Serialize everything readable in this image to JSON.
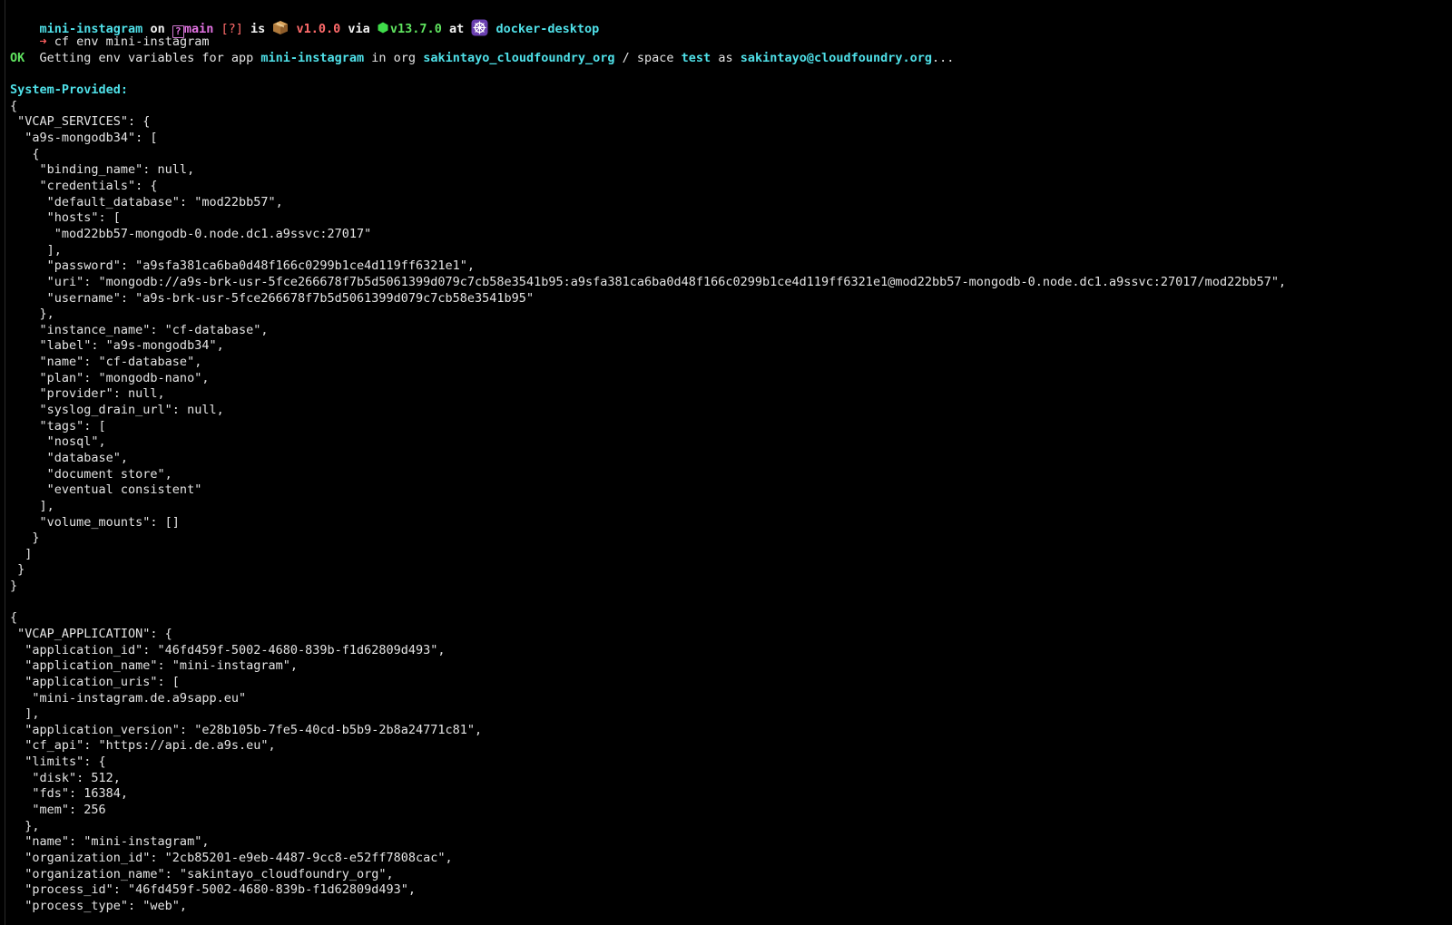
{
  "prompt": {
    "directory": "mini-instagram",
    "on_word": " on ",
    "branch": "main",
    "status": " [?]",
    "is_word": " is ",
    "package_version": " v1.0.0",
    "via_word": " via ",
    "node_version": "v13.7.0",
    "at_word": " at ",
    "context": " docker-desktop"
  },
  "command": {
    "arrow": "➜",
    "text": " cf env mini-instagram"
  },
  "info": {
    "p1": "Getting env variables for app ",
    "app": "mini-instagram",
    "p2": " in org ",
    "org": "sakintayo_cloudfoundry_org",
    "p3": " / space ",
    "space": "test",
    "p4": " as ",
    "user": "sakintayo@cloudfoundry.org",
    "p5": "..."
  },
  "ok": "OK",
  "section_header": "System-Provided:",
  "output_lines": [
    "{",
    " \"VCAP_SERVICES\": {",
    "  \"a9s-mongodb34\": [",
    "   {",
    "    \"binding_name\": null,",
    "    \"credentials\": {",
    "     \"default_database\": \"mod22bb57\",",
    "     \"hosts\": [",
    "      \"mod22bb57-mongodb-0.node.dc1.a9ssvc:27017\"",
    "     ],",
    "     \"password\": \"a9sfa381ca6ba0d48f166c0299b1ce4d119ff6321e1\",",
    "     \"uri\": \"mongodb://a9s-brk-usr-5fce266678f7b5d5061399d079c7cb58e3541b95:a9sfa381ca6ba0d48f166c0299b1ce4d119ff6321e1@mod22bb57-mongodb-0.node.dc1.a9ssvc:27017/mod22bb57\",",
    "     \"username\": \"a9s-brk-usr-5fce266678f7b5d5061399d079c7cb58e3541b95\"",
    "    },",
    "    \"instance_name\": \"cf-database\",",
    "    \"label\": \"a9s-mongodb34\",",
    "    \"name\": \"cf-database\",",
    "    \"plan\": \"mongodb-nano\",",
    "    \"provider\": null,",
    "    \"syslog_drain_url\": null,",
    "    \"tags\": [",
    "     \"nosql\",",
    "     \"database\",",
    "     \"document store\",",
    "     \"eventual consistent\"",
    "    ],",
    "    \"volume_mounts\": []",
    "   }",
    "  ]",
    " }",
    "}",
    "",
    "{",
    " \"VCAP_APPLICATION\": {",
    "  \"application_id\": \"46fd459f-5002-4680-839b-f1d62809d493\",",
    "  \"application_name\": \"mini-instagram\",",
    "  \"application_uris\": [",
    "   \"mini-instagram.de.a9sapp.eu\"",
    "  ],",
    "  \"application_version\": \"e28b105b-7fe5-40cd-b5b9-2b8a24771c81\",",
    "  \"cf_api\": \"https://api.de.a9s.eu\",",
    "  \"limits\": {",
    "   \"disk\": 512,",
    "   \"fds\": 16384,",
    "   \"mem\": 256",
    "  },",
    "  \"name\": \"mini-instagram\",",
    "  \"organization_id\": \"2cb85201-e9eb-4487-9cc8-e52ff7808cac\",",
    "  \"organization_name\": \"sakintayo_cloudfoundry_org\",",
    "  \"process_id\": \"46fd459f-5002-4680-839b-f1d62809d493\",",
    "  \"process_type\": \"web\","
  ],
  "colors": {
    "background": "#000000",
    "text": "#e4e4e4",
    "cyan": "#4fe0e8",
    "green": "#5fe35f",
    "red": "#ff6b6b",
    "magenta": "#e272e2"
  },
  "icons": {
    "branch": "question-box-icon",
    "package": "package-box-icon",
    "node": "node-hexagon-icon",
    "context": "helm-wheel-icon"
  }
}
